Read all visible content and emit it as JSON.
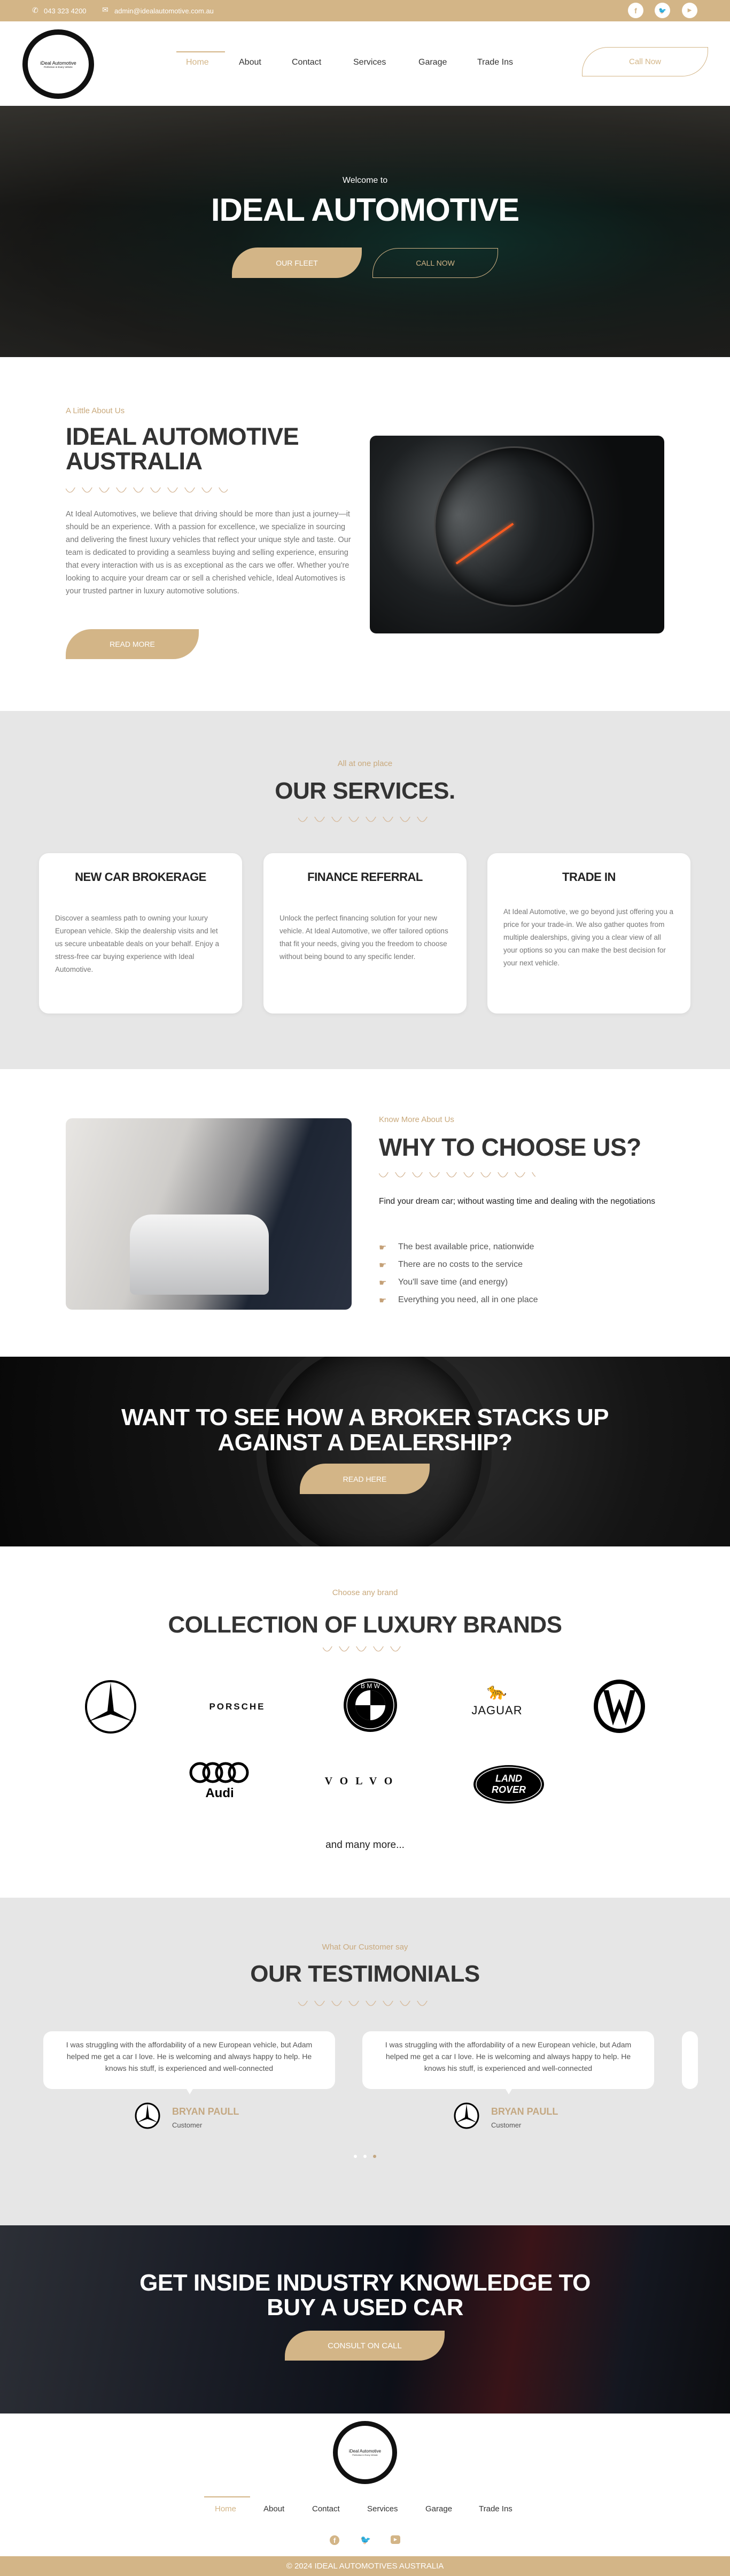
{
  "topbar": {
    "phone": "043 323 4200",
    "email": "admin@idealautomotive.com.au",
    "social": [
      "facebook-icon",
      "twitter-icon",
      "youtube-icon"
    ]
  },
  "logo": {
    "name": "iDeal Automotive",
    "tagline": "Perfection in Every Vehicle"
  },
  "nav": {
    "items": [
      "Home",
      "About",
      "Contact",
      "Services",
      "Garage",
      "Trade Ins"
    ],
    "active": "Home",
    "cta": "Call Now"
  },
  "hero": {
    "kicker": "Welcome to",
    "title": "IDEAL AUTOMOTIVE",
    "primary": "OUR FLEET",
    "secondary": "CALL NOW"
  },
  "about": {
    "label": "A Little About Us",
    "title_line1": "IDEAL AUTOMOTIVE",
    "title_line2": "AUSTRALIA",
    "body": "At Ideal Automotives, we believe that driving should be more than just a journey—it should be an experience. With a passion for excellence, we specialize in sourcing and delivering the finest luxury vehicles that reflect your unique style and taste. Our team is dedicated to providing a seamless buying and selling experience, ensuring that every interaction with us is as exceptional as the cars we offer. Whether you're looking to acquire your dream car or sell a cherished vehicle, Ideal Automotives is your trusted partner in luxury automotive solutions.",
    "button": "READ MORE"
  },
  "services": {
    "label": "All at one place",
    "title": "OUR SERVICES.",
    "cards": [
      {
        "title": "NEW CAR BROKERAGE",
        "text": "Discover a seamless path to owning your luxury European vehicle. Skip the dealership visits and let us secure unbeatable deals on your behalf. Enjoy a stress-free car buying experience with Ideal Automotive."
      },
      {
        "title": "FINANCE REFERRAL",
        "text": "Unlock the perfect financing solution for your new vehicle. At Ideal Automotive, we offer tailored options that fit your needs, giving you the freedom to choose without being bound to any specific lender."
      },
      {
        "title": "TRADE IN",
        "text": "At Ideal Automotive, we go beyond just offering you a price for your trade-in. We also gather quotes from multiple dealerships, giving you a clear view of all your options so you can make the best decision for your next vehicle."
      }
    ]
  },
  "why": {
    "label": "Know More About Us",
    "title": "WHY TO CHOOSE US?",
    "intro": "Find your dream car; without wasting time and dealing with the negotiations",
    "points": [
      "The best available price, nationwide",
      "There are no costs to the service",
      "You'll save time (and energy)",
      "Everything you need, all in one place"
    ]
  },
  "broker": {
    "title_line1": "WANT TO SEE HOW A BROKER STACKS UP",
    "title_line2": "AGAINST A DEALERSHIP?",
    "button": "READ HERE"
  },
  "brands": {
    "label": "Choose any brand",
    "title": "COLLECTION OF LUXURY BRANDS",
    "logos": [
      "Mercedes-Benz",
      "PORSCHE",
      "BMW",
      "JAGUAR",
      "Volkswagen",
      "Audi",
      "VOLVO",
      "LAND ROVER"
    ],
    "more": "and many more..."
  },
  "testimonials": {
    "label": "What Our Customer say",
    "title": "OUR TESTIMONIALS",
    "items": [
      {
        "text": "I was struggling with the affordability of a new European vehicle, but Adam helped me get a car I love. He is welcoming and always happy to help. He knows his stuff, is experienced and well-connected",
        "name": "BRYAN PAULL",
        "role": "Customer"
      },
      {
        "text": "I was struggling with the affordability of a new European vehicle, but Adam helped me get a car I love. He is welcoming and always happy to help. He knows his stuff, is experienced and well-connected",
        "name": "BRYAN PAULL",
        "role": "Customer"
      }
    ],
    "dots": 3,
    "active_dot": 3
  },
  "used": {
    "title_line1": "GET INSIDE INDUSTRY KNOWLEDGE TO",
    "title_line2": "BUY A USED CAR",
    "button": "CONSULT ON CALL"
  },
  "footer": {
    "copyright": "© 2024 IDEAL AUTOMOTIVES AUSTRALIA"
  },
  "colors": {
    "accent": "#d3b587",
    "gray_bg": "#e6e6e6",
    "heading": "#333333"
  }
}
